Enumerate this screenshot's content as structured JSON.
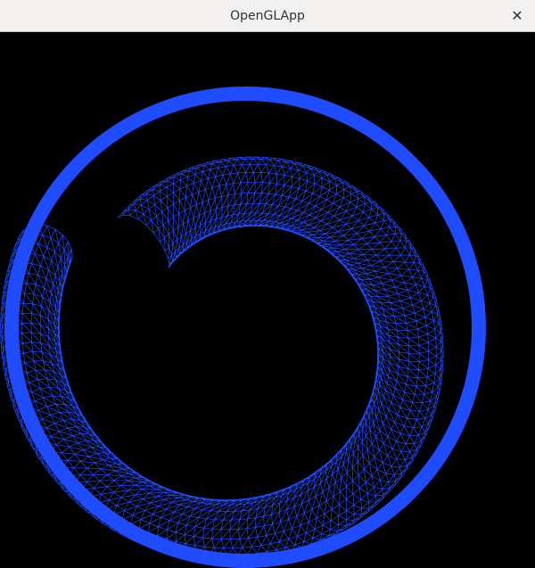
{
  "window": {
    "title": "OpenGLApp",
    "close_glyph": "✕"
  },
  "scene": {
    "background": "#000000",
    "mesh_color": "#1f4cff",
    "rendering": "wireframe-torus-sweep"
  },
  "icons": {
    "close": "close-icon"
  }
}
